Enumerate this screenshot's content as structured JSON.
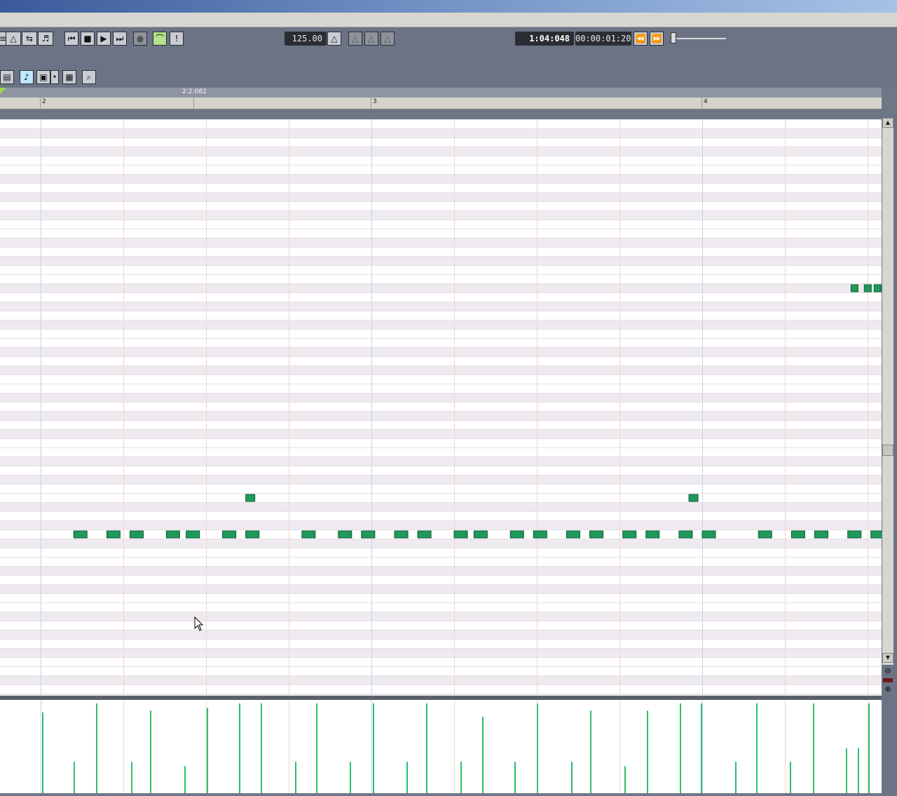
{
  "transport": {
    "tempo": "125.00",
    "position": "1:04:048",
    "time": "00:00:01:20"
  },
  "marker": {
    "label": "2:2:082"
  },
  "ruler": {
    "bar2": "2",
    "bar3": "3",
    "bar4": "4"
  },
  "icons": {
    "go_start": "⏮",
    "stop": "■",
    "play": "▶",
    "go_end": "⏭",
    "record": "●",
    "punch": "!",
    "zoom_out": "⊖",
    "zoom_in": "⊕",
    "search": "🔍",
    "scroll_up": "▲",
    "scroll_down": "▼"
  },
  "colors": {
    "note": "#1e9a5a",
    "velocity": "#2bbf6e",
    "beat_line": "#f4d4c8",
    "bar_line": "#c9d3e0"
  },
  "chart_data": {
    "type": "table",
    "notes_row_low": [
      0.1,
      0.2,
      0.27,
      0.38,
      0.44,
      0.55,
      0.62,
      0.79,
      0.9,
      0.97,
      1.07,
      1.14,
      1.25,
      1.31,
      1.42,
      1.49,
      1.59,
      1.66,
      1.76,
      1.83,
      1.93,
      2.0,
      2.17,
      2.27,
      2.34,
      2.44,
      2.51
    ],
    "notes_row_mid": [
      0.62,
      1.96
    ],
    "notes_row_high": [
      2.45,
      2.49,
      2.52
    ],
    "velocities": [
      0.9,
      0.35,
      1.0,
      0.35,
      0.92,
      0.3,
      0.95,
      1.0,
      1.0,
      0.35,
      1.0,
      0.35,
      1.0,
      0.35,
      1.0,
      0.35,
      0.85,
      0.35,
      1.0,
      0.35,
      0.92,
      0.3,
      0.92,
      1.0,
      1.0,
      0.35,
      1.0,
      0.35,
      1.0,
      0.5,
      0.5,
      1.0
    ]
  }
}
